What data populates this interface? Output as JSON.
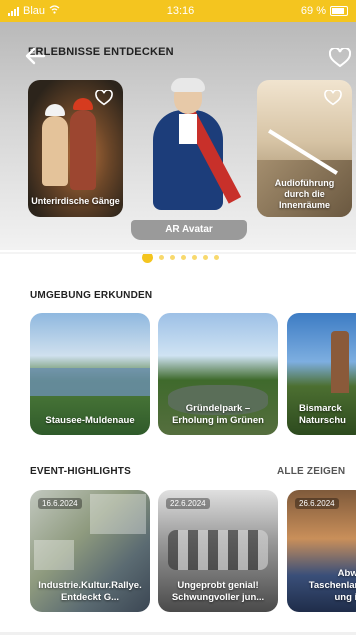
{
  "status_bar": {
    "carrier": "Blau",
    "time": "13:16",
    "battery": "69 %"
  },
  "header": {
    "title": "ERLEBNISSE ENTDECKEN"
  },
  "experiences": [
    {
      "label": "Unterirdische Gänge",
      "icon": "heart-outline-icon"
    },
    {
      "label": "AR Avatar"
    },
    {
      "label": "Audioführung durch die Innenräume",
      "icon": "heart-outline-icon"
    }
  ],
  "carousel": {
    "active_index": 0,
    "dot_count": 7
  },
  "umgebung": {
    "title": "UMGEBUNG ERKUNDEN",
    "cards": [
      {
        "label": "Stausee-Muldenaue"
      },
      {
        "label": "Gründelpark – Erholung im Grünen"
      },
      {
        "label": "Bismarck Naturschu"
      }
    ]
  },
  "events": {
    "title": "EVENT-HIGHLIGHTS",
    "see_all": "ALLE ZEIGEN",
    "cards": [
      {
        "date": "16.6.2024",
        "label": "Industrie.Kultur.Rallye. Entdeckt G..."
      },
      {
        "date": "22.6.2024",
        "label": "Ungeprobt genial! Schwungvoller jun..."
      },
      {
        "date": "26.6.2024",
        "label": "Abwä Taschenlam ung in"
      }
    ]
  },
  "colors": {
    "accent": "#F4C51F",
    "text": "#222222"
  }
}
